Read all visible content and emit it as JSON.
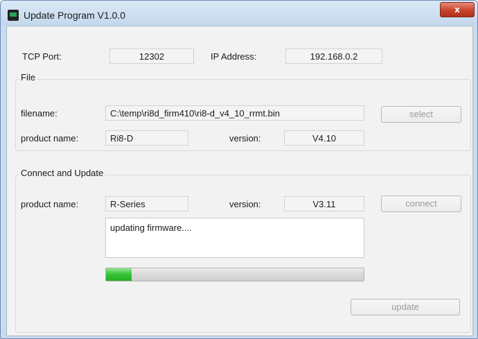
{
  "window": {
    "title": "Update Program V1.0.0",
    "close_label": "x"
  },
  "connection": {
    "tcp_port_label": "TCP Port:",
    "tcp_port_value": "12302",
    "ip_address_label": "IP Address:",
    "ip_address_value": "192.168.0.2"
  },
  "file_group": {
    "title": "File",
    "filename_label": "filename:",
    "filename_value": "C:\\temp\\ri8d_firm410\\ri8-d_v4_10_rrmt.bin",
    "select_label": "select",
    "product_name_label": "product name:",
    "product_name_value": "Ri8-D",
    "version_label": "version:",
    "version_value": "V4.10"
  },
  "update_group": {
    "title": "Connect and Update",
    "product_name_label": "product name:",
    "product_name_value": "R-Series",
    "version_label": "version:",
    "version_value": "V3.11",
    "connect_label": "connect",
    "status_text": "updating firmware....",
    "progress": 0.1,
    "update_label": "update"
  },
  "colors": {
    "progress_fill": "#35c235",
    "close_button": "#c9432e"
  },
  "icons": {
    "app": "app-icon",
    "close": "close-icon"
  }
}
